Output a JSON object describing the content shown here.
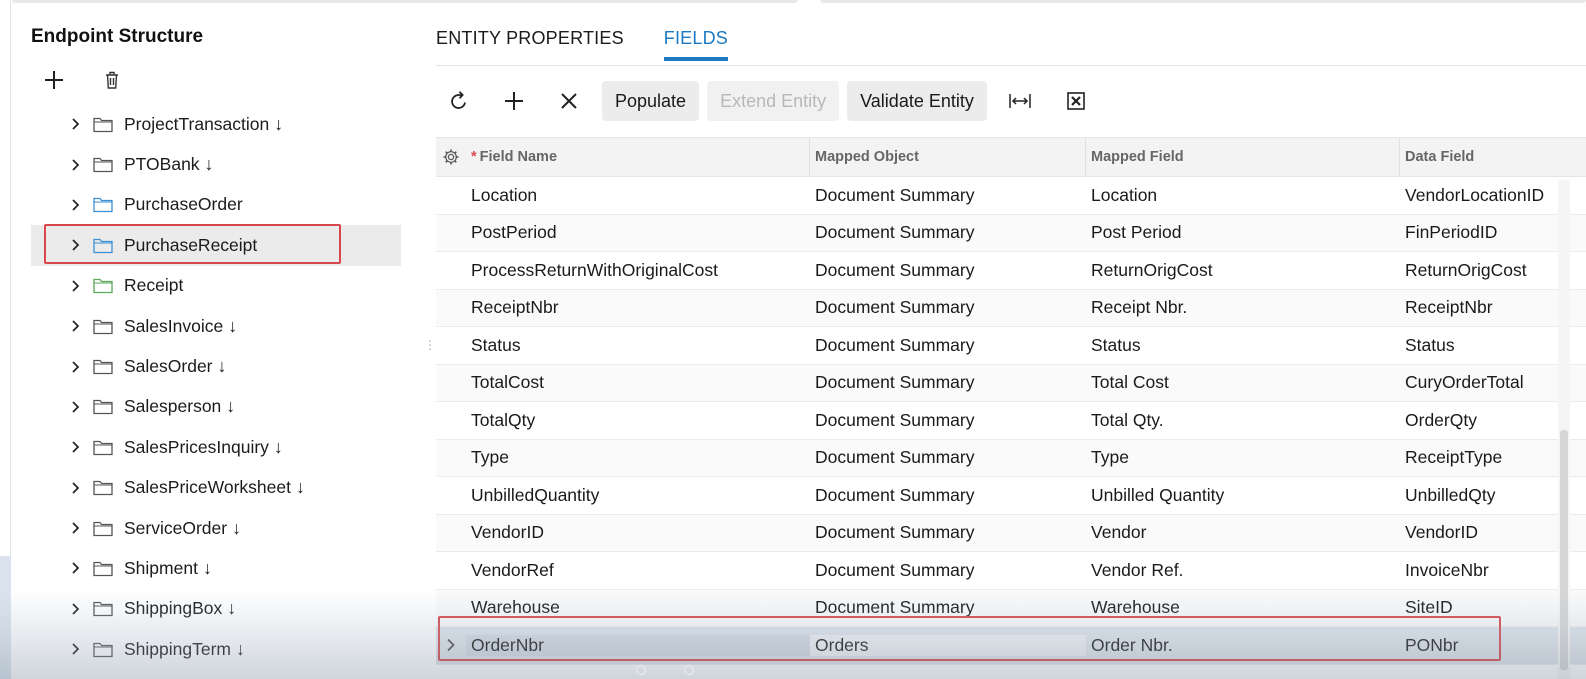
{
  "left": {
    "title": "Endpoint Structure",
    "toolbar": {
      "add_icon": "plus-icon",
      "delete_icon": "trash-icon"
    },
    "tree": [
      {
        "label": "ProjectTransaction",
        "arrow": "↓",
        "folder_color": "#555555",
        "selected": false
      },
      {
        "label": "PTOBank",
        "arrow": "↓",
        "folder_color": "#555555",
        "selected": false
      },
      {
        "label": "PurchaseOrder",
        "arrow": "",
        "folder_color": "#3a8fd6",
        "selected": false
      },
      {
        "label": "PurchaseReceipt",
        "arrow": "",
        "folder_color": "#3a8fd6",
        "selected": true
      },
      {
        "label": "Receipt",
        "arrow": "",
        "folder_color": "#5aa85a",
        "selected": false
      },
      {
        "label": "SalesInvoice",
        "arrow": "↓",
        "folder_color": "#555555",
        "selected": false
      },
      {
        "label": "SalesOrder",
        "arrow": "↓",
        "folder_color": "#555555",
        "selected": false
      },
      {
        "label": "Salesperson",
        "arrow": "↓",
        "folder_color": "#555555",
        "selected": false
      },
      {
        "label": "SalesPricesInquiry",
        "arrow": "↓",
        "folder_color": "#555555",
        "selected": false
      },
      {
        "label": "SalesPriceWorksheet",
        "arrow": "↓",
        "folder_color": "#555555",
        "selected": false
      },
      {
        "label": "ServiceOrder",
        "arrow": "↓",
        "folder_color": "#555555",
        "selected": false
      },
      {
        "label": "Shipment",
        "arrow": "↓",
        "folder_color": "#555555",
        "selected": false
      },
      {
        "label": "ShippingBox",
        "arrow": "↓",
        "folder_color": "#555555",
        "selected": false
      },
      {
        "label": "ShippingTerm",
        "arrow": "↓",
        "folder_color": "#555555",
        "selected": false
      }
    ]
  },
  "tabs": [
    {
      "label": "ENTITY PROPERTIES",
      "active": false
    },
    {
      "label": "FIELDS",
      "active": true
    }
  ],
  "toolbar": {
    "refresh_icon": "refresh-icon",
    "add_icon": "plus-icon",
    "delete_icon": "close-icon",
    "populate": "Populate",
    "extend": "Extend Entity",
    "validate": "Validate Entity",
    "fit_icon": "fit-columns-icon",
    "excel_icon": "excel-export-icon"
  },
  "grid": {
    "headers": {
      "required_mark": "*",
      "field_name": "Field Name",
      "mapped_object": "Mapped Object",
      "mapped_field": "Mapped Field",
      "data_field": "Data Field"
    },
    "rows": [
      {
        "field_name": "Location",
        "mapped_object": "Document Summary",
        "mapped_field": "Location",
        "data_field": "VendorLocationID"
      },
      {
        "field_name": "PostPeriod",
        "mapped_object": "Document Summary",
        "mapped_field": "Post Period",
        "data_field": "FinPeriodID"
      },
      {
        "field_name": "ProcessReturnWithOriginalCost",
        "mapped_object": "Document Summary",
        "mapped_field": "ReturnOrigCost",
        "data_field": "ReturnOrigCost"
      },
      {
        "field_name": "ReceiptNbr",
        "mapped_object": "Document Summary",
        "mapped_field": "Receipt Nbr.",
        "data_field": "ReceiptNbr"
      },
      {
        "field_name": "Status",
        "mapped_object": "Document Summary",
        "mapped_field": "Status",
        "data_field": "Status"
      },
      {
        "field_name": "TotalCost",
        "mapped_object": "Document Summary",
        "mapped_field": "Total Cost",
        "data_field": "CuryOrderTotal"
      },
      {
        "field_name": "TotalQty",
        "mapped_object": "Document Summary",
        "mapped_field": "Total Qty.",
        "data_field": "OrderQty"
      },
      {
        "field_name": "Type",
        "mapped_object": "Document Summary",
        "mapped_field": "Type",
        "data_field": "ReceiptType"
      },
      {
        "field_name": "UnbilledQuantity",
        "mapped_object": "Document Summary",
        "mapped_field": "Unbilled Quantity",
        "data_field": "UnbilledQty"
      },
      {
        "field_name": "VendorID",
        "mapped_object": "Document Summary",
        "mapped_field": "Vendor",
        "data_field": "VendorID"
      },
      {
        "field_name": "VendorRef",
        "mapped_object": "Document Summary",
        "mapped_field": "Vendor Ref.",
        "data_field": "InvoiceNbr"
      },
      {
        "field_name": "Warehouse",
        "mapped_object": "Document Summary",
        "mapped_field": "Warehouse",
        "data_field": "SiteID"
      },
      {
        "field_name": "OrderNbr",
        "mapped_object": "Orders",
        "mapped_field": "Order Nbr.",
        "data_field": "PONbr",
        "current": true
      }
    ]
  },
  "colors": {
    "accent": "#1b7ac3",
    "highlight_box": "#d9464b"
  }
}
